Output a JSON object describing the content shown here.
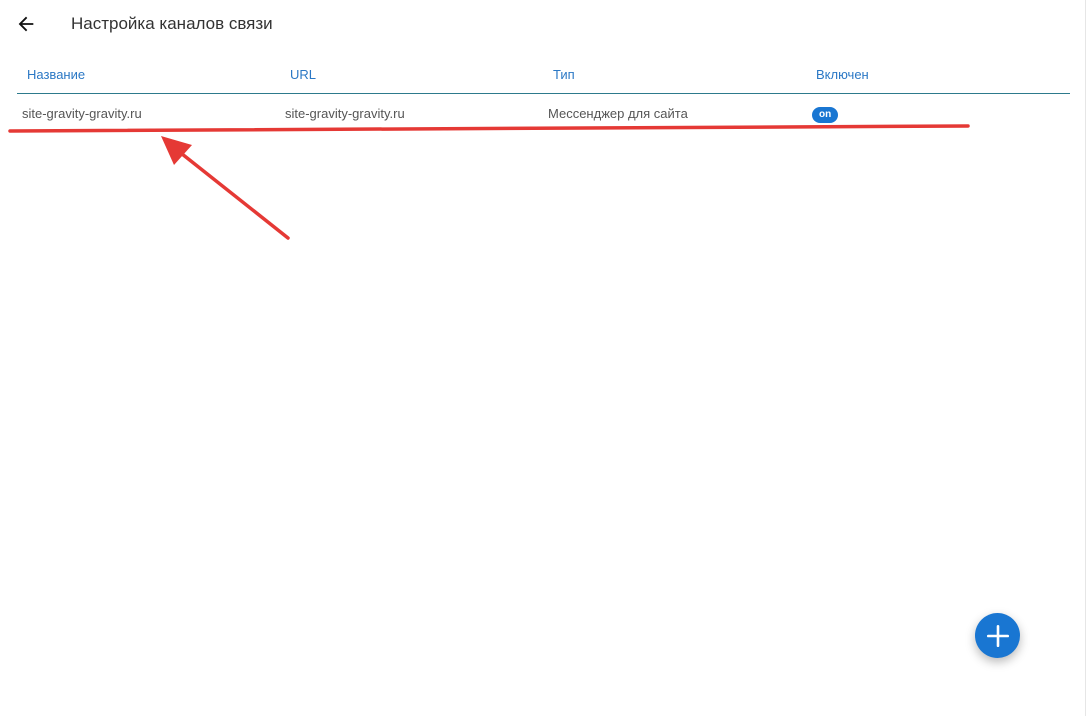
{
  "header": {
    "back_icon": "arrow-left-icon",
    "title": "Настройка каналов связи"
  },
  "table": {
    "columns": {
      "name": "Название",
      "url": "URL",
      "type": "Тип",
      "enabled": "Включен"
    },
    "rows": [
      {
        "name": "site-gravity-gravity.ru",
        "url": "site-gravity-gravity.ru",
        "type": "Мессенджер для сайта",
        "enabled": "on"
      }
    ]
  },
  "fab": {
    "icon": "plus-icon"
  },
  "colors": {
    "accent": "#1976d2",
    "header_text": "#2b78c5",
    "annotation": "#e53935"
  }
}
